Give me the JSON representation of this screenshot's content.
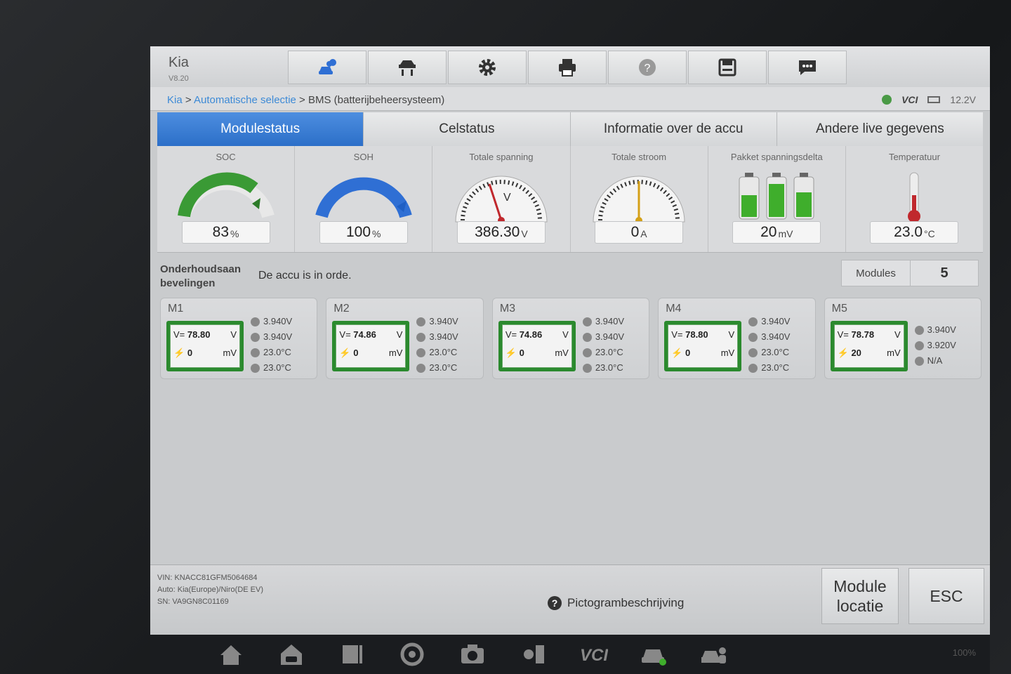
{
  "header": {
    "brand": "Kia",
    "version": "V8.20",
    "toolbar": [
      {
        "icon": "car-cloud-icon"
      },
      {
        "icon": "lift-icon"
      },
      {
        "icon": "gear-icon"
      },
      {
        "icon": "printer-icon"
      },
      {
        "icon": "help-icon"
      },
      {
        "icon": "save-icon"
      },
      {
        "icon": "chat-icon"
      }
    ]
  },
  "breadcrumb": {
    "part1": "Kia",
    "sep1": " > ",
    "part2": "Automatische selectie",
    "sep2": " > ",
    "current": "BMS (batterijbeheersysteem)"
  },
  "status": {
    "vci": "VCI",
    "voltage": "12.2V"
  },
  "tabs": [
    {
      "label": "Modulestatus",
      "active": true
    },
    {
      "label": "Celstatus",
      "active": false
    },
    {
      "label": "Informatie over de accu",
      "active": false
    },
    {
      "label": "Andere live gegevens",
      "active": false
    }
  ],
  "gauges": {
    "soc": {
      "label": "SOC",
      "value": "83",
      "unit": "%",
      "fraction": 0.83
    },
    "soh": {
      "label": "SOH",
      "value": "100",
      "unit": "%",
      "fraction": 1.0
    },
    "voltage": {
      "label": "Totale spanning",
      "value": "386.30",
      "unit": "V"
    },
    "current": {
      "label": "Totale stroom",
      "value": "0",
      "unit": "A"
    },
    "delta": {
      "label": "Pakket spanningsdelta",
      "value": "20",
      "unit": "mV"
    },
    "temp": {
      "label": "Temperatuur",
      "value": "23.0",
      "unit": "°C"
    }
  },
  "maintenance": {
    "label": "Onderhoudsaan bevelingen",
    "text": "De accu is in orde."
  },
  "modules_count": {
    "label": "Modules",
    "value": "5"
  },
  "modules": [
    {
      "name": "M1",
      "v_prefix": "V=",
      "voltage": "78.80",
      "v_unit": "V",
      "delta": "0",
      "d_unit": "mV",
      "stats": [
        "3.940V",
        "3.940V",
        "23.0°C",
        "23.0°C"
      ]
    },
    {
      "name": "M2",
      "v_prefix": "V=",
      "voltage": "74.86",
      "v_unit": "V",
      "delta": "0",
      "d_unit": "mV",
      "stats": [
        "3.940V",
        "3.940V",
        "23.0°C",
        "23.0°C"
      ]
    },
    {
      "name": "M3",
      "v_prefix": "V=",
      "voltage": "74.86",
      "v_unit": "V",
      "delta": "0",
      "d_unit": "mV",
      "stats": [
        "3.940V",
        "3.940V",
        "23.0°C",
        "23.0°C"
      ]
    },
    {
      "name": "M4",
      "v_prefix": "V=",
      "voltage": "78.80",
      "v_unit": "V",
      "delta": "0",
      "d_unit": "mV",
      "stats": [
        "3.940V",
        "3.940V",
        "23.0°C",
        "23.0°C"
      ]
    },
    {
      "name": "M5",
      "v_prefix": "V=",
      "voltage": "78.78",
      "v_unit": "V",
      "delta": "20",
      "d_unit": "mV",
      "stats": [
        "3.940V",
        "3.920V",
        "N/A"
      ]
    }
  ],
  "footer": {
    "vin": "VIN: KNACC81GFM5064684",
    "auto": "Auto: Kia(Europe)/Niro(DE EV)",
    "sn": "SN: VA9GN8C01169",
    "help": "Pictogrambeschrijving",
    "module_locatie_1": "Module",
    "module_locatie_2": "locatie",
    "esc": "ESC"
  },
  "navbar": {
    "status": "100%"
  },
  "colors": {
    "tab_active": "#2c6fc8",
    "soc_gauge": "#3a9a35",
    "soh_gauge": "#2f6fd4",
    "battery_green": "#2b8a2e"
  }
}
